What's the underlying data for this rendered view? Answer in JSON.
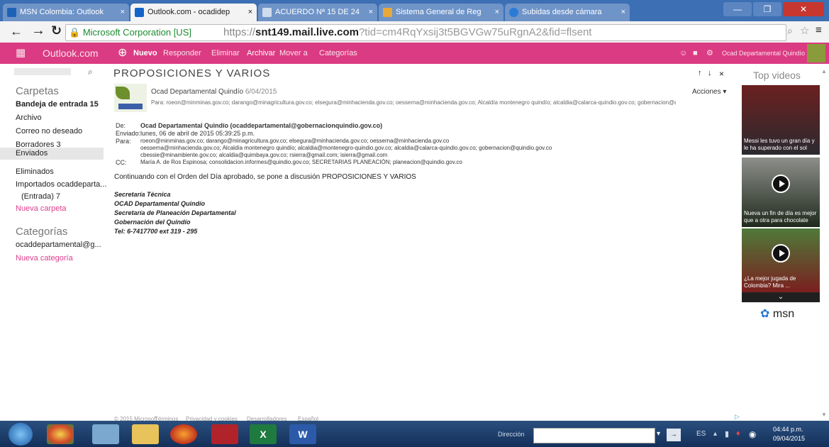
{
  "browser": {
    "tabs": [
      {
        "label": "MSN Colombia: Outlook"
      },
      {
        "label": "Outlook.com - ocadidep"
      },
      {
        "label": "ACUERDO Nª 15 DE 24"
      },
      {
        "label": "Sistema General de Reg"
      },
      {
        "label": "Subidas desde cámara"
      }
    ],
    "secure_label": "Microsoft Corporation [US]",
    "url_scheme": "https",
    "url_host": "snt149.mail.live.com",
    "url_rest": "?tid=cm4RqYxsij3t5BGVGw75uRgnA2&fid=flsent"
  },
  "outlook": {
    "brand": "Outlook.com",
    "toolbar": {
      "new_label": "Nuevo",
      "reply_label": "Responder",
      "delete_label": "Eliminar",
      "archive_label": "Archivar",
      "move_label": "Mover a",
      "categories_label": "Categorías"
    },
    "account_name": "Ocad Departamental Quindío"
  },
  "sidebar": {
    "folders_heading": "Carpetas",
    "folders": [
      {
        "label": "Bandeja de entrada",
        "count": "15"
      },
      {
        "label": "Archivo",
        "count": ""
      },
      {
        "label": "Correo no deseado",
        "count": ""
      },
      {
        "label": "Borradores",
        "count": "3"
      },
      {
        "label": "Enviados",
        "count": ""
      },
      {
        "label": "Eliminados",
        "count": ""
      },
      {
        "label": "Importados ocaddeparta...",
        "count": ""
      },
      {
        "label": "(Entrada)",
        "count": "7"
      }
    ],
    "new_folder": "Nueva carpeta",
    "categories_heading": "Categorías",
    "category_account": "ocaddepartamental@g...",
    "new_category": "Nueva categoría"
  },
  "message": {
    "subject": "PROPOSICIONES Y VARIOS",
    "sender_line": "Ocad Departamental Quindío",
    "sender_date": "6/04/2015",
    "preview_to": "Para: roeon@minminas.gov.co; darango@minagricultura.gov.co; elsegura@minhacienda.gov.co; oesserna@minhacienda.gov.co; Alcaldía montenegro quindío; alcaldia@calarca-quindio.gov.co; gobernacion@quindio.gov.co ...",
    "actions_label": "Acciones",
    "header": {
      "from_label": "De:",
      "from_value": "Ocad Departamental Quindío (ocaddepartamental@gobernacionquindio.gov.co)",
      "sent_label": "Enviado:",
      "sent_value": "lunes, 06 de abril de 2015 05:39:25 p.m.",
      "to_label": "Para:",
      "to_value_1": "roeon@minminas.gov.co; darango@minagricultura.gov.co; elsegura@minhacienda.gov.co; oesserna@minhacienda.gov.co",
      "to_value_2": "oesserna@minhacienda.gov.co; Alcaldía montenegro quindío; alcaldia@montenegro-quindio.gov.co; alcaldia@calarca-quindio.gov.co; gobernacion@quindio.gov.co",
      "to_value_3": "cbessie@minambiente.gov.co; alcaldia@quimbaya.gov.co; rsierra@gmail.com; isierra@gmail.com",
      "cc_label": "CC:",
      "cc_value": "María A. de Ros Espinosa; consolidacion.informes@quindio.gov.co; SECRETARIAS PLANEACIÓN; planeacion@quindio.gov.co"
    },
    "body": "Continuando con el Orden del Día aprobado, se pone a discusión PROPOSICIONES Y VARIOS",
    "signature": [
      "Secretaría Técnica",
      "OCAD Departamental Quindío",
      "Secretaría de Planeación Departamental",
      "Gobernación del Quindío",
      "Tel: 6-7417700 ext 319 - 295"
    ]
  },
  "rail": {
    "title": "Top videos",
    "videos": [
      {
        "caption": "Messi les tuvo un gran día y le ha superado con el sol"
      },
      {
        "caption": "Nueva un fin de día es mejor que a otra para chocolate"
      },
      {
        "caption": "¿La mejor jugada de Colombia? Mira ..."
      }
    ],
    "msn_label": "msn"
  },
  "footer": {
    "copyright": "© 2015 Microsoft",
    "terms": "Términos",
    "privacy": "Privacidad y cookies",
    "developers": "Desarrolladores",
    "language": "Español"
  },
  "taskbar": {
    "search_label": "Dirección",
    "time": "04:44 p.m.",
    "date": "09/04/2015"
  },
  "colors": {
    "outlook_header": "#db3b82",
    "browser_chrome": "#3c6fb4",
    "accent_pink": "#e03c8c"
  }
}
